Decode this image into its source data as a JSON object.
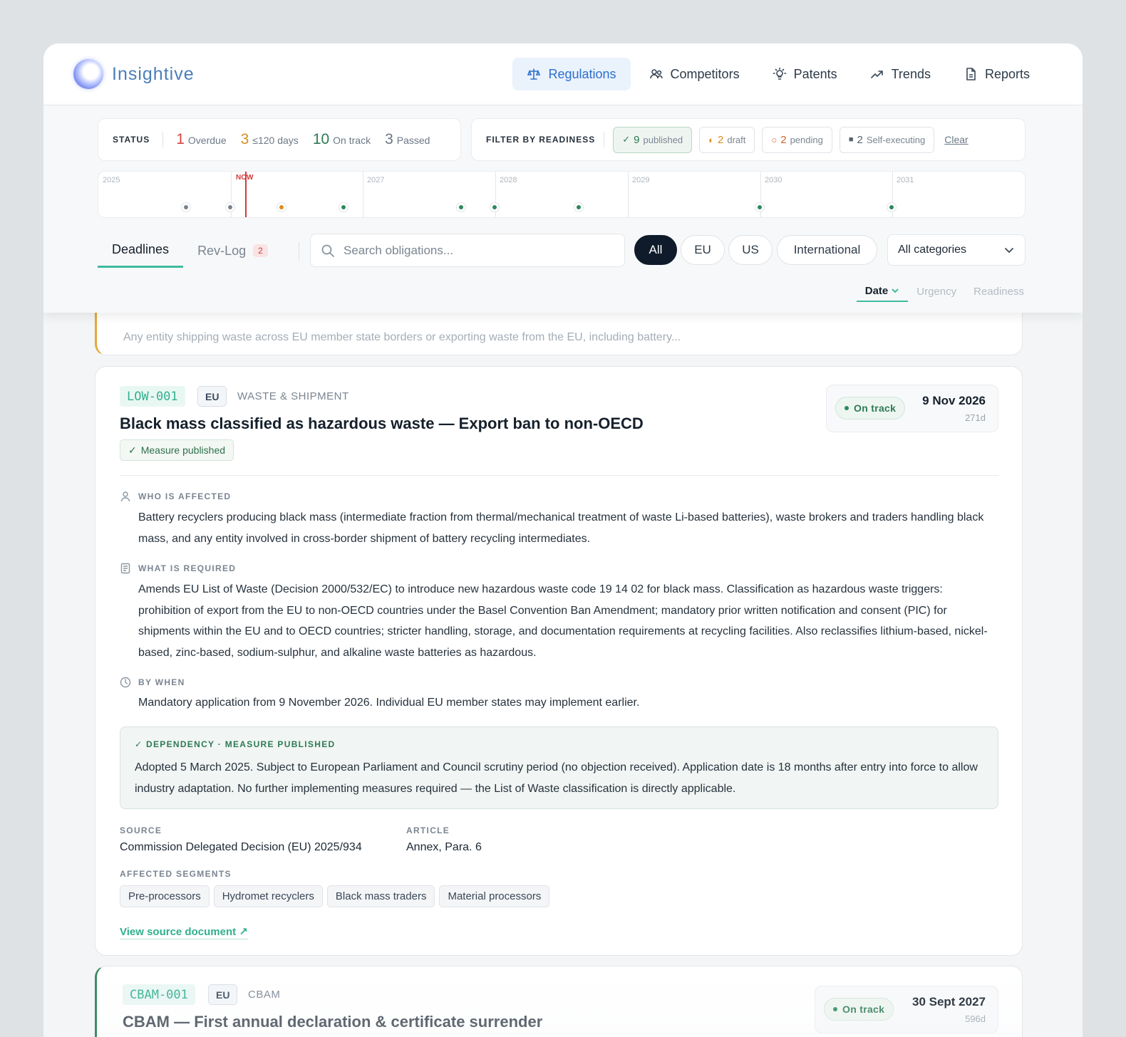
{
  "brand": {
    "name": "Insightive"
  },
  "nav": {
    "items": [
      {
        "label": "Regulations",
        "icon": "scale-icon"
      },
      {
        "label": "Competitors",
        "icon": "users-icon"
      },
      {
        "label": "Patents",
        "icon": "lightbulb-icon"
      },
      {
        "label": "Trends",
        "icon": "trend-icon"
      },
      {
        "label": "Reports",
        "icon": "document-icon"
      }
    ],
    "active": "Regulations"
  },
  "status": {
    "label": "STATUS",
    "items": [
      {
        "count": "1",
        "label": "Overdue",
        "color": "#d64545"
      },
      {
        "count": "3",
        "label": "≤120 days",
        "color": "#d88f1f"
      },
      {
        "count": "10",
        "label": "On track",
        "color": "#2d7a55"
      },
      {
        "count": "3",
        "label": "Passed",
        "color": "#6b7580"
      }
    ]
  },
  "filter": {
    "label": "FILTER BY READINESS",
    "chips": [
      {
        "mark": "✓",
        "count": "9",
        "label": "published",
        "color": "#2d7a55"
      },
      {
        "mark": "◐",
        "count": "2",
        "label": "draft",
        "color": "#d88f1f"
      },
      {
        "mark": "○",
        "count": "2",
        "label": "pending",
        "color": "#d0622d"
      },
      {
        "mark": "■",
        "count": "2",
        "label": "Self-executing",
        "color": "#56616d"
      }
    ],
    "clear": "Clear"
  },
  "timeline": {
    "years": [
      "2025",
      "2027",
      "2028",
      "2029",
      "2030",
      "2031"
    ],
    "now_label": "NOW"
  },
  "tabs": {
    "deadlines": "Deadlines",
    "revlog": "Rev-Log",
    "revlog_count": "2"
  },
  "search": {
    "placeholder": "Search obligations..."
  },
  "jurisdictions": [
    "All",
    "EU",
    "US",
    "International"
  ],
  "category_select": "All categories",
  "sort": {
    "date": "Date",
    "urgency": "Urgency",
    "readiness": "Readiness"
  },
  "prev_card": {
    "summary": "Any entity shipping waste across EU member state borders or exporting waste from the EU, including battery..."
  },
  "card": {
    "code": "LOW-001",
    "region": "EU",
    "category": "WASTE & SHIPMENT",
    "title": "Black mass classified as hazardous waste — Export ban to non-OECD",
    "readiness": "Measure published",
    "status": "On track",
    "date": "9 Nov 2026",
    "days_left": "271d",
    "who_label": "WHO IS AFFECTED",
    "who_text": "Battery recyclers producing black mass (intermediate fraction from thermal/mechanical treatment of waste Li-based batteries), waste brokers and traders handling black mass, and any entity involved in cross-border shipment of battery recycling intermediates.",
    "what_label": "WHAT IS REQUIRED",
    "what_text": "Amends EU List of Waste (Decision 2000/532/EC) to introduce new hazardous waste code 19 14 02 for black mass. Classification as hazardous waste triggers: prohibition of export from the EU to non-OECD countries under the Basel Convention Ban Amendment; mandatory prior written notification and consent (PIC) for shipments within the EU and to OECD countries; stricter handling, storage, and documentation requirements at recycling facilities. Also reclassifies lithium-based, nickel-based, zinc-based, sodium-sulphur, and alkaline waste batteries as hazardous.",
    "when_label": "BY WHEN",
    "when_text": "Mandatory application from 9 November 2026. Individual EU member states may implement earlier.",
    "dependency_label": "DEPENDENCY · MEASURE PUBLISHED",
    "dependency_text": "Adopted 5 March 2025. Subject to European Parliament and Council scrutiny period (no objection received). Application date is 18 months after entry into force to allow industry adaptation. No further implementing measures required — the List of Waste classification is directly applicable.",
    "source_label": "SOURCE",
    "source": "Commission Delegated Decision (EU) 2025/934",
    "article_label": "ARTICLE",
    "article": "Annex, Para. 6",
    "segments_label": "AFFECTED SEGMENTS",
    "segments": [
      "Pre-processors",
      "Hydromet recyclers",
      "Black mass traders",
      "Material processors"
    ],
    "source_link": "View source document ↗"
  },
  "next_card": {
    "code": "CBAM-001",
    "region": "EU",
    "category": "CBAM",
    "title": "CBAM — First annual declaration & certificate surrender",
    "status": "On track",
    "date": "30 Sept 2027",
    "days_left": "596d"
  }
}
